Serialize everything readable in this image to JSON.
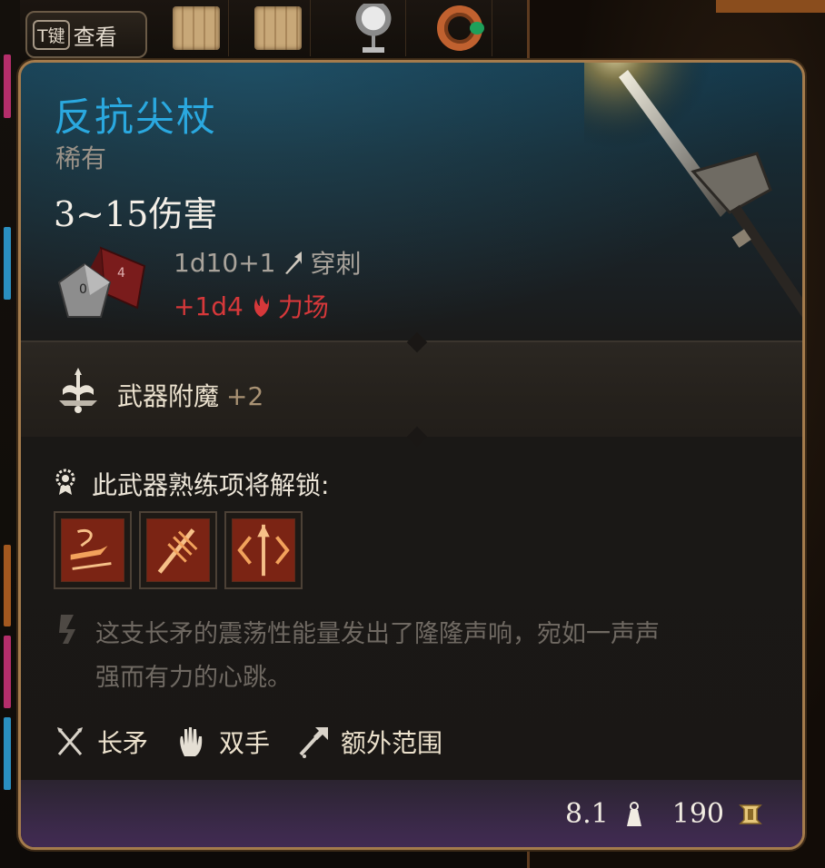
{
  "key_hint": {
    "key": "T键",
    "label": "查看"
  },
  "item": {
    "name": "反抗尖杖",
    "rarity": "稀有",
    "damage": "3~15伤害",
    "rolls": [
      {
        "dice": "1d10+1",
        "type": "穿刺",
        "icon": "piercing-icon"
      },
      {
        "dice": "+1d4",
        "type": "力场",
        "icon": "force-icon"
      }
    ],
    "enchantment": {
      "label": "武器附魔",
      "value": "+2"
    },
    "proficiency_title": "此武器熟练项将解锁:",
    "proficiency_actions": [
      "action-icon-1",
      "action-icon-2",
      "action-icon-3"
    ],
    "flavor_text_line1": "这支长矛的震荡性能量发出了隆隆声响，宛如一声声",
    "flavor_text_line2": "强而有力的心跳。",
    "properties": [
      {
        "label": "长矛",
        "icon": "spear-type-icon"
      },
      {
        "label": "双手",
        "icon": "two-handed-icon"
      },
      {
        "label": "额外范围",
        "icon": "reach-icon"
      }
    ],
    "weight": "8.1",
    "price": "190"
  },
  "colors": {
    "name": "#2aa8df",
    "force_damage": "#d6383a",
    "border": "#a47b4c",
    "footer": "#432b55"
  }
}
